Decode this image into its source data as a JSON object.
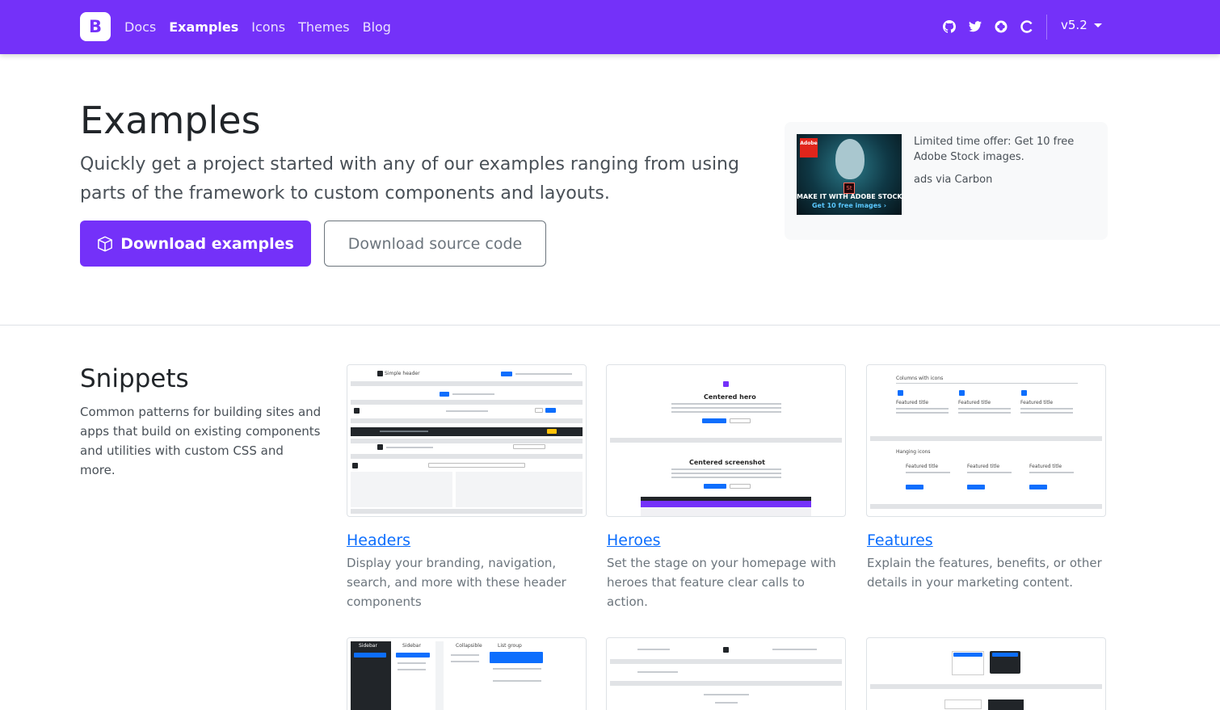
{
  "navbar": {
    "brand": "B",
    "links": [
      "Docs",
      "Examples",
      "Icons",
      "Themes",
      "Blog"
    ],
    "active": "Examples",
    "icons": [
      "github-icon",
      "twitter-icon",
      "opencollective-icon",
      "loading-icon"
    ],
    "version": "v5.2",
    "color": "#7431f9"
  },
  "hero": {
    "title": "Examples",
    "lead": "Quickly get a project started with any of our examples ranging from using parts of the framework to custom components and layouts.",
    "primary_button": "Download examples",
    "secondary_button": "Download source code"
  },
  "ad": {
    "text": "Limited time offer: Get 10 free Adobe Stock images.",
    "via": "ads via Carbon",
    "image_logo": "Adobe",
    "image_badge": "St",
    "image_caption": "MAKE IT WITH ADOBE STOCK.",
    "image_cta": "Get 10 free images ›"
  },
  "snippets": {
    "title": "Snippets",
    "description": "Common patterns for building sites and apps that build on existing components and utilities with custom CSS and more.",
    "cards": [
      {
        "title": "Headers",
        "description": "Display your branding, navigation, search, and more with these header components"
      },
      {
        "title": "Heroes",
        "description": "Set the stage on your homepage with heroes that feature clear calls to action."
      },
      {
        "title": "Features",
        "description": "Explain the features, benefits, or other details in your marketing content."
      }
    ]
  },
  "thumbs": {
    "headers_label": "Simple header",
    "hero1": "Centered hero",
    "hero2": "Centered screenshot",
    "features1": "Columns with icons",
    "features2": "Hanging icons",
    "feature_title": "Featured title",
    "sidebar": "Sidebar",
    "collapsible": "Collapsible",
    "list_group": "List group"
  }
}
